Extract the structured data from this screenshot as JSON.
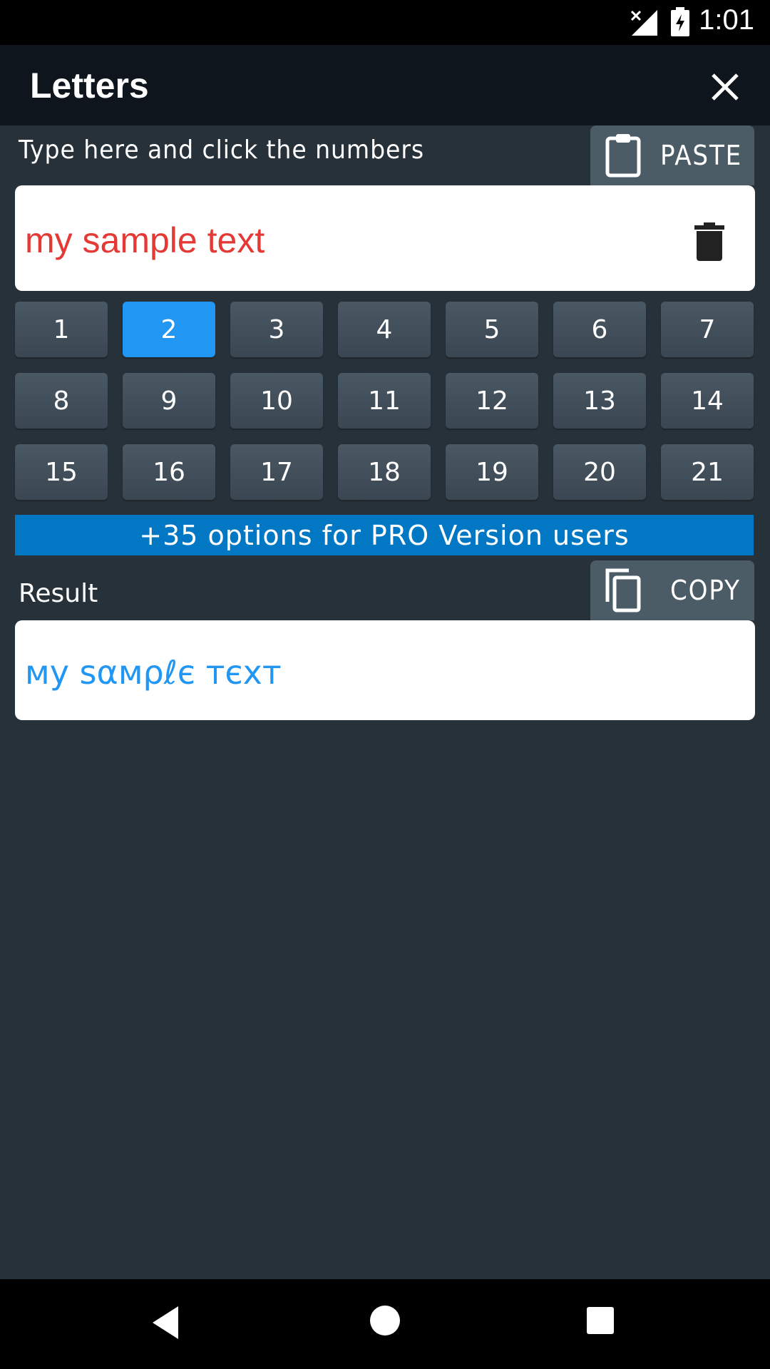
{
  "status_bar": {
    "time": "1:01"
  },
  "app_bar": {
    "title": "Letters",
    "close_icon": "close-icon"
  },
  "input_section": {
    "label": "Type here and click the numbers",
    "paste_label": "PASTE",
    "paste_icon": "clipboard-icon",
    "input_value": "my sample text",
    "clear_icon": "trash-icon"
  },
  "number_buttons": {
    "selected": "2",
    "labels": [
      "1",
      "2",
      "3",
      "4",
      "5",
      "6",
      "7",
      "8",
      "9",
      "10",
      "11",
      "12",
      "13",
      "14",
      "15",
      "16",
      "17",
      "18",
      "19",
      "20",
      "21"
    ]
  },
  "pro_banner": {
    "text": "+35 options for PRO Version users"
  },
  "result_section": {
    "label": "Result",
    "copy_label": "COPY",
    "copy_icon": "copy-icon",
    "result_value": "мy sαмρℓє тєxт"
  },
  "colors": {
    "background": "#27313a",
    "app_bar": "#0f151c",
    "accent": "#2196f3",
    "banner": "#0277c4",
    "input_text": "#e53935"
  },
  "nav_bar": {
    "icons": [
      "back-icon",
      "home-icon",
      "recents-icon"
    ]
  }
}
